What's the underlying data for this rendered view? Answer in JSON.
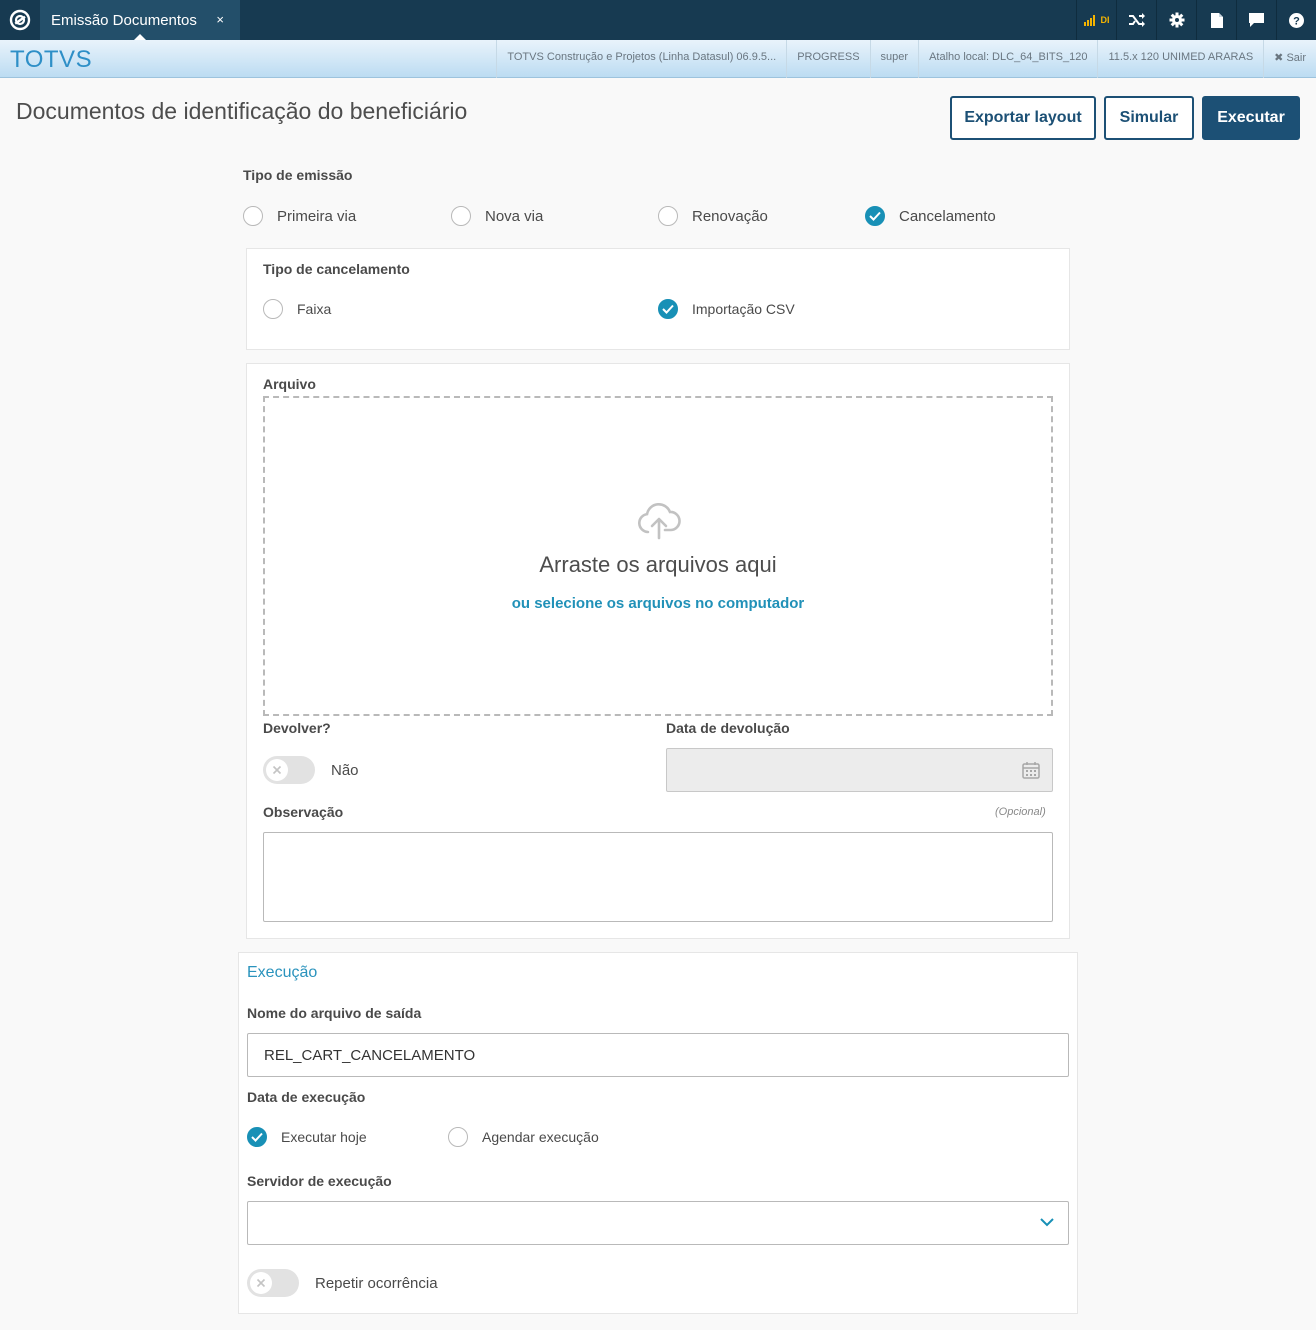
{
  "topbar": {
    "tab_title": "Emissão Documentos",
    "tab_close": "×",
    "di_label": "DI"
  },
  "header": {
    "brand": "TOTVS",
    "info": [
      "TOTVS Construção e Projetos (Linha Datasul) 06.9.5...",
      "PROGRESS",
      "super",
      "Atalho local: DLC_64_BITS_120",
      "11.5.x 120 UNIMED ARARAS"
    ],
    "exit_label": "Sair"
  },
  "page": {
    "title": "Documentos de identificação do beneficiário",
    "actions": {
      "export": "Exportar layout",
      "simulate": "Simular",
      "execute": "Executar"
    }
  },
  "emission": {
    "label": "Tipo de emissão",
    "options": [
      "Primeira via",
      "Nova via",
      "Renovação",
      "Cancelamento"
    ],
    "selected": "Cancelamento"
  },
  "cancellation": {
    "label": "Tipo de cancelamento",
    "options": [
      "Faixa",
      "Importação CSV"
    ],
    "selected": "Importação CSV"
  },
  "file": {
    "label": "Arquivo",
    "drop_title": "Arraste os arquivos aqui",
    "drop_link": "ou selecione os arquivos no computador"
  },
  "return": {
    "label": "Devolver?",
    "toggle_value": "Não",
    "date_label": "Data de devolução"
  },
  "observation": {
    "label": "Observação",
    "optional": "(Opcional)"
  },
  "execution": {
    "title": "Execução",
    "output_label": "Nome do arquivo de saída",
    "output_value": "REL_CART_CANCELAMENTO",
    "date_label": "Data de execução",
    "date_options": [
      "Executar hoje",
      "Agendar execução"
    ],
    "date_selected": "Executar hoje",
    "server_label": "Servidor de execução",
    "server_value": "",
    "repeat_label": "Repetir ocorrência"
  },
  "colors": {
    "topbar": "#173a51",
    "primary": "#1c5075",
    "accent": "#1890b6",
    "link": "#2191b8"
  }
}
